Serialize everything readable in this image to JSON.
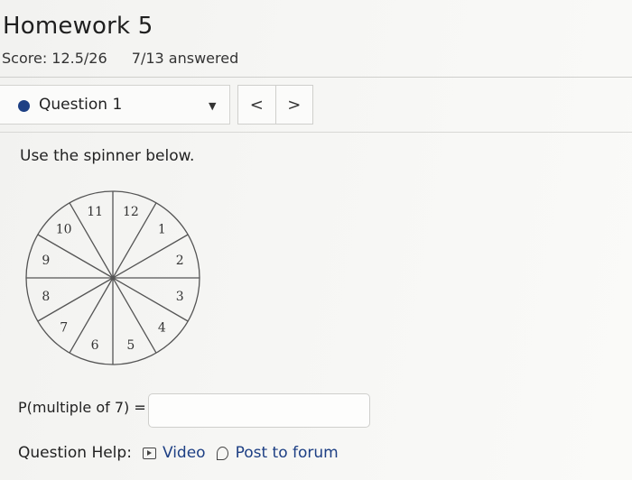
{
  "header": {
    "title": "Homework 5",
    "score": "Score: 12.5/26",
    "answered": "7/13 answered"
  },
  "question_nav": {
    "current": "Question 1",
    "prev": "<",
    "next": ">"
  },
  "question": {
    "prompt": "Use the spinner below.",
    "spinner_numbers": [
      "12",
      "1",
      "2",
      "3",
      "4",
      "5",
      "6",
      "7",
      "8",
      "9",
      "10",
      "11"
    ],
    "answer_label": "P(multiple of 7) =",
    "answer_value": ""
  },
  "help": {
    "label": "Question Help:",
    "video": "Video",
    "forum": "Post to forum"
  },
  "colors": {
    "accent": "#1d3f84"
  }
}
